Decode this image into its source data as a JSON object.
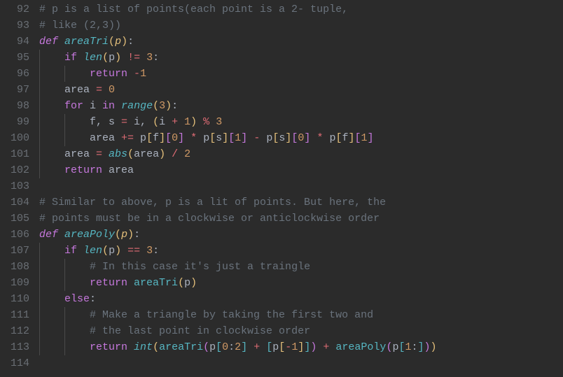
{
  "lines": [
    {
      "num": "92",
      "indent": 0,
      "tokens": [
        {
          "cls": "comment",
          "txt": "# p is a list of points(each point is a 2- tuple,"
        }
      ]
    },
    {
      "num": "93",
      "indent": 0,
      "tokens": [
        {
          "cls": "comment",
          "txt": "# like (2,3))"
        }
      ]
    },
    {
      "num": "94",
      "indent": 0,
      "tokens": [
        {
          "cls": "def",
          "txt": "def"
        },
        {
          "cls": "plain",
          "txt": " "
        },
        {
          "cls": "funcname",
          "txt": "areaTri"
        },
        {
          "cls": "bracket-y",
          "txt": "("
        },
        {
          "cls": "param",
          "txt": "p"
        },
        {
          "cls": "bracket-y",
          "txt": ")"
        },
        {
          "cls": "plain",
          "txt": ":"
        }
      ]
    },
    {
      "num": "95",
      "indent": 1,
      "tokens": [
        {
          "cls": "plain",
          "txt": "    "
        },
        {
          "cls": "keyword-ctrl",
          "txt": "if"
        },
        {
          "cls": "plain",
          "txt": " "
        },
        {
          "cls": "builtin",
          "txt": "len"
        },
        {
          "cls": "bracket-y",
          "txt": "("
        },
        {
          "cls": "plain",
          "txt": "p"
        },
        {
          "cls": "bracket-y",
          "txt": ")"
        },
        {
          "cls": "plain",
          "txt": " "
        },
        {
          "cls": "operator",
          "txt": "!="
        },
        {
          "cls": "plain",
          "txt": " "
        },
        {
          "cls": "number",
          "txt": "3"
        },
        {
          "cls": "plain",
          "txt": ":"
        }
      ]
    },
    {
      "num": "96",
      "indent": 2,
      "tokens": [
        {
          "cls": "plain",
          "txt": "        "
        },
        {
          "cls": "keyword-ctrl",
          "txt": "return"
        },
        {
          "cls": "plain",
          "txt": " "
        },
        {
          "cls": "operator",
          "txt": "-"
        },
        {
          "cls": "number",
          "txt": "1"
        }
      ]
    },
    {
      "num": "97",
      "indent": 1,
      "tokens": [
        {
          "cls": "plain",
          "txt": "    area "
        },
        {
          "cls": "operator",
          "txt": "="
        },
        {
          "cls": "plain",
          "txt": " "
        },
        {
          "cls": "number",
          "txt": "0"
        }
      ]
    },
    {
      "num": "98",
      "indent": 1,
      "tokens": [
        {
          "cls": "plain",
          "txt": "    "
        },
        {
          "cls": "keyword-ctrl",
          "txt": "for"
        },
        {
          "cls": "plain",
          "txt": " i "
        },
        {
          "cls": "keyword-ctrl",
          "txt": "in"
        },
        {
          "cls": "plain",
          "txt": " "
        },
        {
          "cls": "builtin",
          "txt": "range"
        },
        {
          "cls": "bracket-y",
          "txt": "("
        },
        {
          "cls": "number",
          "txt": "3"
        },
        {
          "cls": "bracket-y",
          "txt": ")"
        },
        {
          "cls": "plain",
          "txt": ":"
        }
      ]
    },
    {
      "num": "99",
      "indent": 2,
      "tokens": [
        {
          "cls": "plain",
          "txt": "        f, s "
        },
        {
          "cls": "operator",
          "txt": "="
        },
        {
          "cls": "plain",
          "txt": " i, "
        },
        {
          "cls": "bracket-y",
          "txt": "("
        },
        {
          "cls": "plain",
          "txt": "i "
        },
        {
          "cls": "operator",
          "txt": "+"
        },
        {
          "cls": "plain",
          "txt": " "
        },
        {
          "cls": "number",
          "txt": "1"
        },
        {
          "cls": "bracket-y",
          "txt": ")"
        },
        {
          "cls": "plain",
          "txt": " "
        },
        {
          "cls": "operator",
          "txt": "%"
        },
        {
          "cls": "plain",
          "txt": " "
        },
        {
          "cls": "number",
          "txt": "3"
        }
      ]
    },
    {
      "num": "100",
      "indent": 2,
      "tokens": [
        {
          "cls": "plain",
          "txt": "        area "
        },
        {
          "cls": "operator",
          "txt": "+="
        },
        {
          "cls": "plain",
          "txt": " p"
        },
        {
          "cls": "bracket-y",
          "txt": "["
        },
        {
          "cls": "plain",
          "txt": "f"
        },
        {
          "cls": "bracket-y",
          "txt": "]"
        },
        {
          "cls": "bracket-p",
          "txt": "["
        },
        {
          "cls": "number",
          "txt": "0"
        },
        {
          "cls": "bracket-p",
          "txt": "]"
        },
        {
          "cls": "plain",
          "txt": " "
        },
        {
          "cls": "operator",
          "txt": "*"
        },
        {
          "cls": "plain",
          "txt": " p"
        },
        {
          "cls": "bracket-y",
          "txt": "["
        },
        {
          "cls": "plain",
          "txt": "s"
        },
        {
          "cls": "bracket-y",
          "txt": "]"
        },
        {
          "cls": "bracket-p",
          "txt": "["
        },
        {
          "cls": "number",
          "txt": "1"
        },
        {
          "cls": "bracket-p",
          "txt": "]"
        },
        {
          "cls": "plain",
          "txt": " "
        },
        {
          "cls": "operator",
          "txt": "-"
        },
        {
          "cls": "plain",
          "txt": " p"
        },
        {
          "cls": "bracket-y",
          "txt": "["
        },
        {
          "cls": "plain",
          "txt": "s"
        },
        {
          "cls": "bracket-y",
          "txt": "]"
        },
        {
          "cls": "bracket-p",
          "txt": "["
        },
        {
          "cls": "number",
          "txt": "0"
        },
        {
          "cls": "bracket-p",
          "txt": "]"
        },
        {
          "cls": "plain",
          "txt": " "
        },
        {
          "cls": "operator",
          "txt": "*"
        },
        {
          "cls": "plain",
          "txt": " p"
        },
        {
          "cls": "bracket-y",
          "txt": "["
        },
        {
          "cls": "plain",
          "txt": "f"
        },
        {
          "cls": "bracket-y",
          "txt": "]"
        },
        {
          "cls": "bracket-p",
          "txt": "["
        },
        {
          "cls": "number",
          "txt": "1"
        },
        {
          "cls": "bracket-p",
          "txt": "]"
        }
      ]
    },
    {
      "num": "101",
      "indent": 1,
      "tokens": [
        {
          "cls": "plain",
          "txt": "    area "
        },
        {
          "cls": "operator",
          "txt": "="
        },
        {
          "cls": "plain",
          "txt": " "
        },
        {
          "cls": "builtin",
          "txt": "abs"
        },
        {
          "cls": "bracket-y",
          "txt": "("
        },
        {
          "cls": "plain",
          "txt": "area"
        },
        {
          "cls": "bracket-y",
          "txt": ")"
        },
        {
          "cls": "plain",
          "txt": " "
        },
        {
          "cls": "operator",
          "txt": "/"
        },
        {
          "cls": "plain",
          "txt": " "
        },
        {
          "cls": "number",
          "txt": "2"
        }
      ]
    },
    {
      "num": "102",
      "indent": 1,
      "tokens": [
        {
          "cls": "plain",
          "txt": "    "
        },
        {
          "cls": "keyword-ctrl",
          "txt": "return"
        },
        {
          "cls": "plain",
          "txt": " area"
        }
      ]
    },
    {
      "num": "103",
      "indent": 0,
      "tokens": []
    },
    {
      "num": "104",
      "indent": 0,
      "tokens": [
        {
          "cls": "comment",
          "txt": "# Similar to above, p is a lit of points. But here, the"
        }
      ]
    },
    {
      "num": "105",
      "indent": 0,
      "tokens": [
        {
          "cls": "comment",
          "txt": "# points must be in a clockwise or anticlockwise order"
        }
      ]
    },
    {
      "num": "106",
      "indent": 0,
      "tokens": [
        {
          "cls": "def",
          "txt": "def"
        },
        {
          "cls": "plain",
          "txt": " "
        },
        {
          "cls": "funcname",
          "txt": "areaPoly"
        },
        {
          "cls": "bracket-y",
          "txt": "("
        },
        {
          "cls": "param",
          "txt": "p"
        },
        {
          "cls": "bracket-y",
          "txt": ")"
        },
        {
          "cls": "plain",
          "txt": ":"
        }
      ]
    },
    {
      "num": "107",
      "indent": 1,
      "tokens": [
        {
          "cls": "plain",
          "txt": "    "
        },
        {
          "cls": "keyword-ctrl",
          "txt": "if"
        },
        {
          "cls": "plain",
          "txt": " "
        },
        {
          "cls": "builtin",
          "txt": "len"
        },
        {
          "cls": "bracket-y",
          "txt": "("
        },
        {
          "cls": "plain",
          "txt": "p"
        },
        {
          "cls": "bracket-y",
          "txt": ")"
        },
        {
          "cls": "plain",
          "txt": " "
        },
        {
          "cls": "operator",
          "txt": "=="
        },
        {
          "cls": "plain",
          "txt": " "
        },
        {
          "cls": "number",
          "txt": "3"
        },
        {
          "cls": "plain",
          "txt": ":"
        }
      ]
    },
    {
      "num": "108",
      "indent": 2,
      "tokens": [
        {
          "cls": "plain",
          "txt": "        "
        },
        {
          "cls": "comment",
          "txt": "# In this case it's just a traingle"
        }
      ]
    },
    {
      "num": "109",
      "indent": 2,
      "tokens": [
        {
          "cls": "plain",
          "txt": "        "
        },
        {
          "cls": "keyword-ctrl",
          "txt": "return"
        },
        {
          "cls": "plain",
          "txt": " "
        },
        {
          "cls": "funcname-call",
          "txt": "areaTri"
        },
        {
          "cls": "bracket-y",
          "txt": "("
        },
        {
          "cls": "plain",
          "txt": "p"
        },
        {
          "cls": "bracket-y",
          "txt": ")"
        }
      ]
    },
    {
      "num": "110",
      "indent": 1,
      "tokens": [
        {
          "cls": "plain",
          "txt": "    "
        },
        {
          "cls": "keyword-ctrl",
          "txt": "else"
        },
        {
          "cls": "plain",
          "txt": ":"
        }
      ]
    },
    {
      "num": "111",
      "indent": 2,
      "tokens": [
        {
          "cls": "plain",
          "txt": "        "
        },
        {
          "cls": "comment",
          "txt": "# Make a triangle by taking the first two and"
        }
      ]
    },
    {
      "num": "112",
      "indent": 2,
      "tokens": [
        {
          "cls": "plain",
          "txt": "        "
        },
        {
          "cls": "comment",
          "txt": "# the last point in clockwise order"
        }
      ]
    },
    {
      "num": "113",
      "indent": 2,
      "tokens": [
        {
          "cls": "plain",
          "txt": "        "
        },
        {
          "cls": "keyword-ctrl",
          "txt": "return"
        },
        {
          "cls": "plain",
          "txt": " "
        },
        {
          "cls": "builtin",
          "txt": "int"
        },
        {
          "cls": "bracket-y",
          "txt": "("
        },
        {
          "cls": "funcname-call",
          "txt": "areaTri"
        },
        {
          "cls": "bracket-p",
          "txt": "("
        },
        {
          "cls": "plain",
          "txt": "p"
        },
        {
          "cls": "bracket-b",
          "txt": "["
        },
        {
          "cls": "number",
          "txt": "0"
        },
        {
          "cls": "plain",
          "txt": ":"
        },
        {
          "cls": "number",
          "txt": "2"
        },
        {
          "cls": "bracket-b",
          "txt": "]"
        },
        {
          "cls": "plain",
          "txt": " "
        },
        {
          "cls": "operator",
          "txt": "+"
        },
        {
          "cls": "plain",
          "txt": " "
        },
        {
          "cls": "bracket-b",
          "txt": "["
        },
        {
          "cls": "plain",
          "txt": "p"
        },
        {
          "cls": "bracket-y",
          "txt": "["
        },
        {
          "cls": "operator",
          "txt": "-"
        },
        {
          "cls": "number",
          "txt": "1"
        },
        {
          "cls": "bracket-y",
          "txt": "]"
        },
        {
          "cls": "bracket-b",
          "txt": "]"
        },
        {
          "cls": "bracket-p",
          "txt": ")"
        },
        {
          "cls": "plain",
          "txt": " "
        },
        {
          "cls": "operator",
          "txt": "+"
        },
        {
          "cls": "plain",
          "txt": " "
        },
        {
          "cls": "funcname-call",
          "txt": "areaPoly"
        },
        {
          "cls": "bracket-p",
          "txt": "("
        },
        {
          "cls": "plain",
          "txt": "p"
        },
        {
          "cls": "bracket-b",
          "txt": "["
        },
        {
          "cls": "number",
          "txt": "1"
        },
        {
          "cls": "plain",
          "txt": ":"
        },
        {
          "cls": "bracket-b",
          "txt": "]"
        },
        {
          "cls": "bracket-p",
          "txt": ")"
        },
        {
          "cls": "bracket-y",
          "txt": ")"
        }
      ]
    },
    {
      "num": "114",
      "indent": 0,
      "tokens": []
    }
  ]
}
